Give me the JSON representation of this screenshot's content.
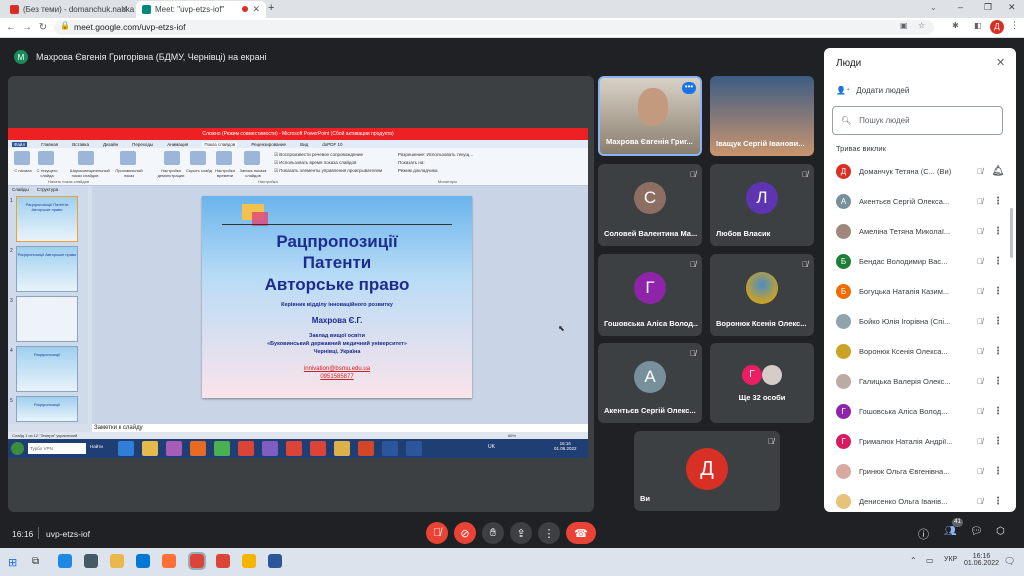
{
  "browser": {
    "tabs": [
      {
        "label": "(Без теми) - domanchuk.nauka@",
        "active": false
      },
      {
        "label": "Meet: \"uvp-etzs-iof\"",
        "active": true
      }
    ],
    "url": "meet.google.com/uvp-etzs-iof",
    "profile_initial": "Д"
  },
  "meet": {
    "presenting_label": "Махрова Євгенія Григорівна (БДМУ, Чернівці) на екрані",
    "presenter_initial": "М",
    "time": "16:16",
    "meeting_code": "uvp-etzs-iof",
    "participant_count": "41"
  },
  "shared_screen": {
    "ppt_title": "Сложно (Режим совместимости)  -  Microsoft PowerPoint (Сбой активации продукта)",
    "ppt_tabs": [
      "Файл",
      "Главная",
      "Вставка",
      "Дизайн",
      "Переходы",
      "Анимация",
      "Показ слайдов",
      "Рецензирование",
      "Вид",
      "doPDF 10"
    ],
    "ribbon_labels": [
      "С начала",
      "С текущего слайда",
      "Широковещательный показ слайдов",
      "Произвольный показ",
      "Настройка демонстрации",
      "Скрыть слайд",
      "Настройка времени",
      "Запись показа слайдов"
    ],
    "checkbox_labels": [
      "Воспроизвести речевое сопровождение",
      "Использовать время показа слайдов",
      "Показать элементы управления проигрывателем"
    ],
    "monitor_labels": [
      "Разрешение:",
      "Использовать текущ...",
      "Показать на:",
      "Режим докладчика"
    ],
    "group_labels": [
      "Начать показ слайдов",
      "Настройка",
      "Мониторы"
    ],
    "panel_tabs": [
      "Слайды",
      "Структура"
    ],
    "thumbs": [
      "Рацпропозиції Патенти Авторське право",
      "Рацпропозиції Авторське право",
      "",
      "Рацпропозиції",
      "Рацпропозиції"
    ],
    "slide": {
      "title1": "Рацпропозиції",
      "title2": "Патенти",
      "title3": "Авторське право",
      "subtitle": "Керівник відділу інноваційного розвитку",
      "author": "Махрова Є.Г.",
      "org1": "Заклад вищої освіти",
      "org2": "«Буковинський державний медичний університет»",
      "city": "Чернівці, Україна",
      "email": "innivation@bsmu.edu.ua",
      "phone": "0951585877"
    },
    "notes": "Заметки к слайду",
    "status_left": "Слайд 1 из 12   \"Эпигра\"   украинский",
    "zoom": "66%",
    "inner_clock": "16:16",
    "inner_date": "01.06.2022",
    "inner_lang": "UK",
    "search_placeholder": "Турбо VPN",
    "find_label": "Найти"
  },
  "tiles": [
    {
      "name": "Махрова Євгенія Григ...",
      "initial": "",
      "color": "#6b5a4a",
      "video": true
    },
    {
      "name": "Іващук Сергій Іванови...",
      "initial": "",
      "color": "#5a6a80",
      "video": true
    },
    {
      "name": "Соловей Валентина Ма...",
      "initial": "С",
      "color": "#8d6e63"
    },
    {
      "name": "Любов Власик",
      "initial": "Л",
      "color": "#5e35b1"
    },
    {
      "name": "Гошовська Аліса Волод...",
      "initial": "Г",
      "color": "#8e24aa"
    },
    {
      "name": "Воронюк Ксенія Олекс...",
      "initial": "",
      "color": "#c9a227"
    },
    {
      "name": "Акентьєв Сергій Олекс...",
      "initial": "А",
      "color": "#78909c"
    },
    {
      "name": "Ще 32 особи",
      "initial": "Г",
      "color": "#e91e63"
    },
    {
      "name": "Ви",
      "initial": "Д",
      "color": "#d93025"
    }
  ],
  "people_panel": {
    "title": "Люди",
    "add_label": "Додати людей",
    "search_placeholder": "Пошук людей",
    "section": "Триває виклик",
    "people": [
      {
        "name": "Доманчук Тетяна (С... (Ви)",
        "initial": "Д",
        "color": "#d93025"
      },
      {
        "name": "Акентьєв Сергій Олекса...",
        "initial": "А",
        "color": "#78909c"
      },
      {
        "name": "Амеліна Тетяна Миколаї...",
        "initial": "",
        "color": "#a1887f"
      },
      {
        "name": "Бендас Володимир Вас...",
        "initial": "Б",
        "color": "#1e7e34"
      },
      {
        "name": "Богуцька Наталія Казим...",
        "initial": "Б",
        "color": "#ef6c00"
      },
      {
        "name": "Бойко Юлія Ігорівна (Спі...",
        "initial": "",
        "color": "#90a4ae"
      },
      {
        "name": "Воронюк Ксенія Олекса...",
        "initial": "",
        "color": "#c9a227"
      },
      {
        "name": "Галицька Валерія Олекс...",
        "initial": "",
        "color": "#bcaaa4"
      },
      {
        "name": "Гошовська Аліса Волод...",
        "initial": "Г",
        "color": "#8e24aa"
      },
      {
        "name": "Грималюк Наталія Андрії...",
        "initial": "Г",
        "color": "#d81b60"
      },
      {
        "name": "Гринюк Ольга Євгенівна...",
        "initial": "",
        "color": "#d7a9a0"
      },
      {
        "name": "Денисенко Ольга Іванів...",
        "initial": "",
        "color": "#e6c27a"
      }
    ]
  },
  "taskbar": {
    "time": "16:16",
    "date": "01.06.2022",
    "lang": "УКР"
  }
}
